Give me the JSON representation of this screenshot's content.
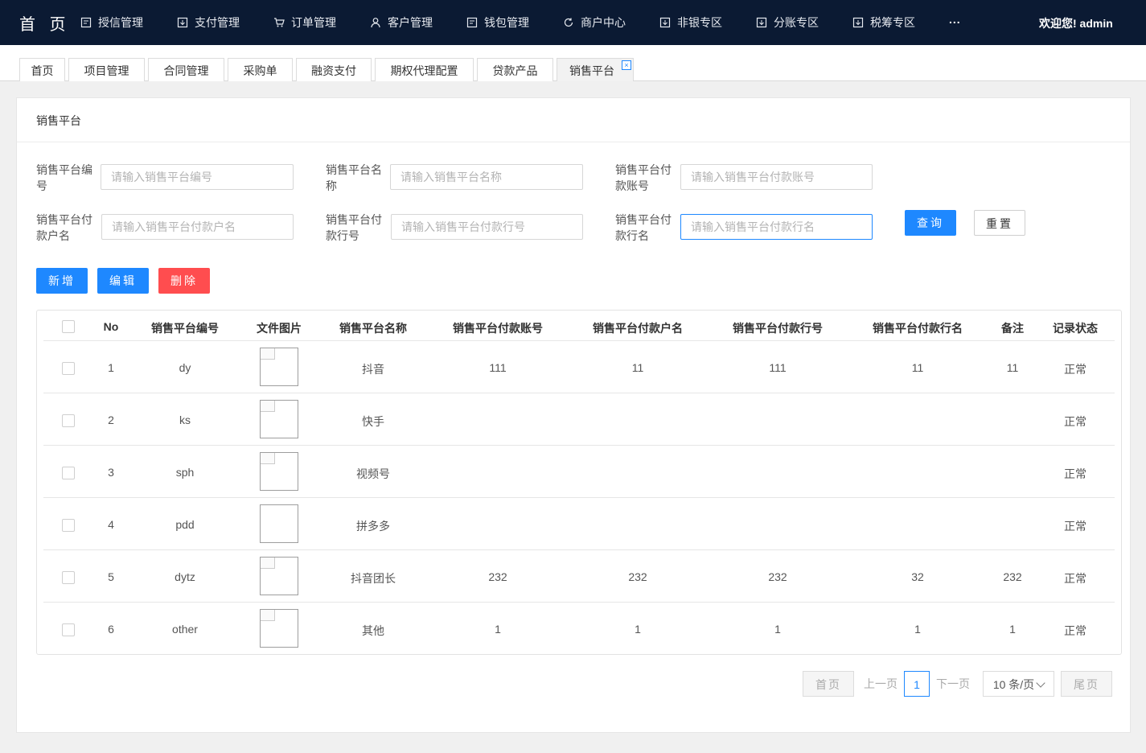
{
  "header": {
    "brand": "首 页",
    "nav": [
      {
        "label": "授信管理",
        "icon": "doc-icon"
      },
      {
        "label": "支付管理",
        "icon": "download-icon"
      },
      {
        "label": "订单管理",
        "icon": "cart-icon"
      },
      {
        "label": "客户管理",
        "icon": "user-icon"
      },
      {
        "label": "钱包管理",
        "icon": "doc-icon"
      },
      {
        "label": "商户中心",
        "icon": "refresh-icon"
      },
      {
        "label": "非银专区",
        "icon": "download-icon"
      },
      {
        "label": "分账专区",
        "icon": "download-icon"
      },
      {
        "label": "税筹专区",
        "icon": "download-icon"
      }
    ],
    "more": "...",
    "welcome": "欢迎您! admin"
  },
  "tabs": [
    {
      "label": "首页"
    },
    {
      "label": "项目管理"
    },
    {
      "label": "合同管理"
    },
    {
      "label": "采购单"
    },
    {
      "label": "融资支付"
    },
    {
      "label": "期权代理配置"
    },
    {
      "label": "贷款产品"
    },
    {
      "label": "销售平台",
      "active": true
    }
  ],
  "tab_close": "×",
  "panel": {
    "title": "销售平台"
  },
  "form": {
    "code_label": "销售平台编号",
    "code_placeholder": "请输入销售平台编号",
    "name_label": "销售平台名称",
    "name_placeholder": "请输入销售平台名称",
    "account_label": "销售平台付款账号",
    "account_placeholder": "请输入销售平台付款账号",
    "payer_label": "销售平台付款户名",
    "payer_placeholder": "请输入销售平台付款户名",
    "bankno_label": "销售平台付款行号",
    "bankno_placeholder": "请输入销售平台付款行号",
    "bankname_label": "销售平台付款行名",
    "bankname_placeholder": "请输入销售平台付款行名",
    "query_button": "查询",
    "reset_button": "重置"
  },
  "toolbar": {
    "add": "新增",
    "edit": "编辑",
    "delete": "删除"
  },
  "table": {
    "headers": [
      "No",
      "销售平台编号",
      "文件图片",
      "销售平台名称",
      "销售平台付款账号",
      "销售平台付款户名",
      "销售平台付款行号",
      "销售平台付款行名",
      "备注",
      "记录状态"
    ],
    "rows": [
      {
        "no": "1",
        "code": "dy",
        "name": "抖音",
        "account": "111",
        "payer": "11",
        "bankno": "111",
        "bankname": "11",
        "remark": "11",
        "status": "正常",
        "image": "broken-image"
      },
      {
        "no": "2",
        "code": "ks",
        "name": "快手",
        "account": "",
        "payer": "",
        "bankno": "",
        "bankname": "",
        "remark": "",
        "status": "正常",
        "image": "broken-image"
      },
      {
        "no": "3",
        "code": "sph",
        "name": "视频号",
        "account": "",
        "payer": "",
        "bankno": "",
        "bankname": "",
        "remark": "",
        "status": "正常",
        "image": "broken-image"
      },
      {
        "no": "4",
        "code": "pdd",
        "name": "拼多多",
        "account": "",
        "payer": "",
        "bankno": "",
        "bankname": "",
        "remark": "",
        "status": "正常",
        "image": "empty-image"
      },
      {
        "no": "5",
        "code": "dytz",
        "name": "抖音团长",
        "account": "232",
        "payer": "232",
        "bankno": "232",
        "bankname": "32",
        "remark": "232",
        "status": "正常",
        "image": "broken-image"
      },
      {
        "no": "6",
        "code": "other",
        "name": "其他",
        "account": "1",
        "payer": "1",
        "bankno": "1",
        "bankname": "1",
        "remark": "1",
        "status": "正常",
        "image": "broken-image"
      }
    ]
  },
  "pagination": {
    "first": "首页",
    "prev": "上一页",
    "current": "1",
    "next": "下一页",
    "page_size": "10 条/页",
    "last": "尾页"
  },
  "colors": {
    "nav_bg": "#0b1a33",
    "primary": "#1e88ff",
    "danger": "#ff4d4f"
  }
}
